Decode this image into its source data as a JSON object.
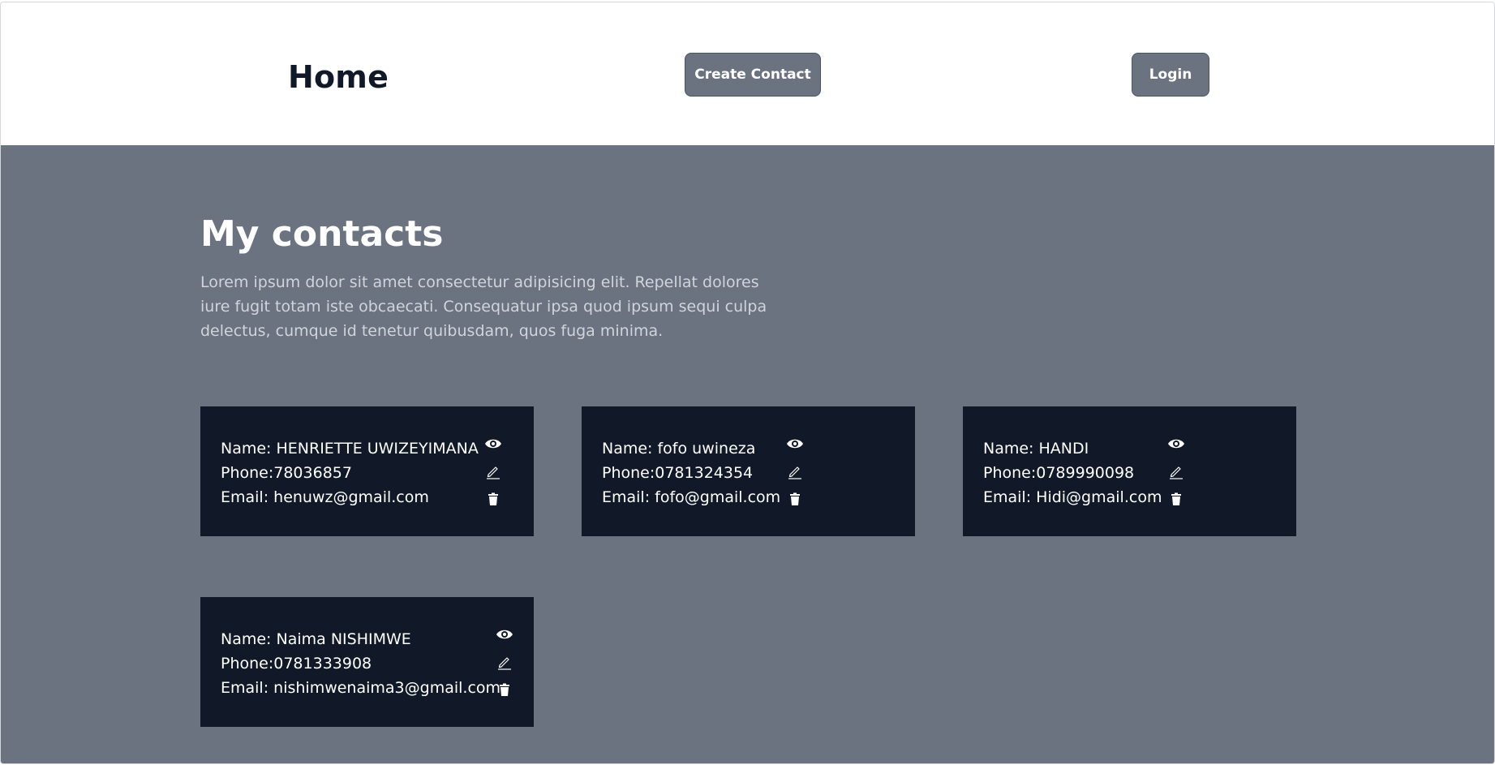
{
  "navbar": {
    "title": "Home",
    "create_label": "Create Contact",
    "login_label": "Login"
  },
  "main": {
    "heading": "My contacts",
    "description": "Lorem ipsum dolor sit amet consectetur adipisicing elit. Repellat dolores iure fugit totam iste obcaecati. Consequatur ipsa quod ipsum sequi culpa delectus, cumque id tenetur quibusdam, quos fuga minima."
  },
  "contacts": [
    {
      "name": "Name: HENRIETTE UWIZEYIMANA",
      "phone": "Phone:78036857",
      "email": "Email: henuwz@gmail.com"
    },
    {
      "name": "Name: fofo uwineza",
      "phone": "Phone:0781324354",
      "email": "Email: fofo@gmail.com"
    },
    {
      "name": "Name: HANDI",
      "phone": "Phone:0789990098",
      "email": "Email: Hidi@gmail.com"
    },
    {
      "name": "Name: Naima NISHIMWE",
      "phone": "Phone:0781333908",
      "email": "Email: nishimwenaima3@gmail.com"
    }
  ],
  "icons": {
    "view": "eye-icon",
    "edit": "pencil-icon",
    "delete": "trash-icon"
  },
  "colors": {
    "navbar_bg": "#ffffff",
    "content_bg": "#6b7280",
    "card_bg": "#111827",
    "button_bg": "#6b7280"
  }
}
